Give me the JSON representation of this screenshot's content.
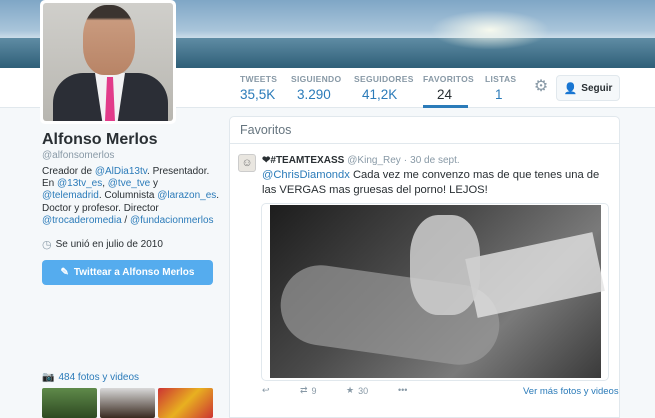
{
  "profile": {
    "name": "Alfonso Merlos",
    "handle": "@alfonsomerlos",
    "bio": {
      "p1": "Creador de ",
      "l1": "@AlDia13tv",
      "p2": ". Presentador. En ",
      "l2": "@13tv_es",
      "p3": ", ",
      "l3": "@tve_tve",
      "p4": " y ",
      "l4": "@telemadrid",
      "p5": ". Columnista ",
      "l5": "@larazon_es",
      "p6": ". Doctor y profesor. Director ",
      "l6": "@trocaderomedia",
      "p7": " / ",
      "l7": "@fundacionmerlos"
    },
    "joined": "Se unió en julio de 2010",
    "tweet_to_label": "Twittear a Alfonso Merlos",
    "photos_label": "484 fotos y videos"
  },
  "stats": [
    {
      "label": "TWEETS",
      "value": "35,5K"
    },
    {
      "label": "SIGUIENDO",
      "value": "3.290"
    },
    {
      "label": "SEGUIDORES",
      "value": "41,2K"
    },
    {
      "label": "FAVORITOS",
      "value": "24"
    },
    {
      "label": "LISTAS",
      "value": "1"
    }
  ],
  "follow_label": "Seguir",
  "panel": {
    "title": "Favoritos",
    "tweet": {
      "name": "❤#TEAMTEXASS",
      "screen_name": "@King_Rey",
      "sep": "·",
      "date": "30 de sept.",
      "mention": "@ChrisDiamondx",
      "text": " Cada vez me convenzo mas de que tenes una de las VERGAS mas gruesas del porno! LEJOS!",
      "retweets": "9",
      "favorites": "30",
      "more_media": "Ver más fotos y videos"
    }
  },
  "icons": {
    "gear": "gear-icon",
    "follow": "add-user-icon",
    "calendar": "clock-icon",
    "compose": "compose-icon",
    "camera": "camera-icon",
    "reply": "reply-icon",
    "retweet": "retweet-icon",
    "favorite": "star-icon",
    "more": "more-icon"
  },
  "colors": {
    "link": "#2b7bb9",
    "button": "#55acee",
    "muted": "#8899a6"
  }
}
